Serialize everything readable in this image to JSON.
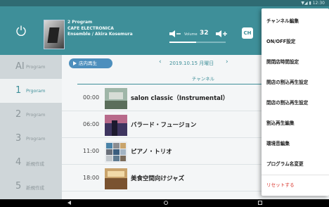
{
  "statusbar": {
    "icons": "▼◢ ▮ 12:30"
  },
  "header": {
    "now_playing": {
      "program": "2 Program",
      "channel": "CAFE ELECTRONICA",
      "artists": "Ensemble / Akira Kosemura"
    },
    "volume": {
      "label": "Volume",
      "value": "32",
      "level": 0.48
    },
    "ch_icon_label": "CH"
  },
  "sidebar": {
    "items": [
      {
        "num": "AI",
        "label": "Program"
      },
      {
        "num": "1",
        "label": "Prgoram"
      },
      {
        "num": "2",
        "label": "Program"
      },
      {
        "num": "3",
        "label": "Program"
      },
      {
        "num": "4",
        "label": "新規作成"
      },
      {
        "num": "5",
        "label": "新規作成"
      }
    ],
    "selected_index": 1
  },
  "main": {
    "store_play_label": "店内再生",
    "date": "2019.10.15 月曜日",
    "column_header": "チャンネル",
    "rows": [
      {
        "time": "00:00",
        "title": "salon classic（Instrumental）"
      },
      {
        "time": "06:00",
        "title": "バラード・フュージョン"
      },
      {
        "time": "11:00",
        "title": "ピアノ・トリオ"
      },
      {
        "time": "18:00",
        "title": "美食空間向けジャズ"
      }
    ]
  },
  "menu": {
    "items": [
      {
        "label": "チャンネル編集"
      },
      {
        "label": "ON/OFF設定"
      },
      {
        "label": "開閉店時間設定"
      },
      {
        "label": "開店の割込再生設定"
      },
      {
        "label": "閉店の割込再生設定"
      },
      {
        "label": "割込再生編集"
      },
      {
        "label": "環境音編集"
      },
      {
        "label": "プログラム名変更"
      },
      {
        "label": "リセットする"
      }
    ]
  }
}
